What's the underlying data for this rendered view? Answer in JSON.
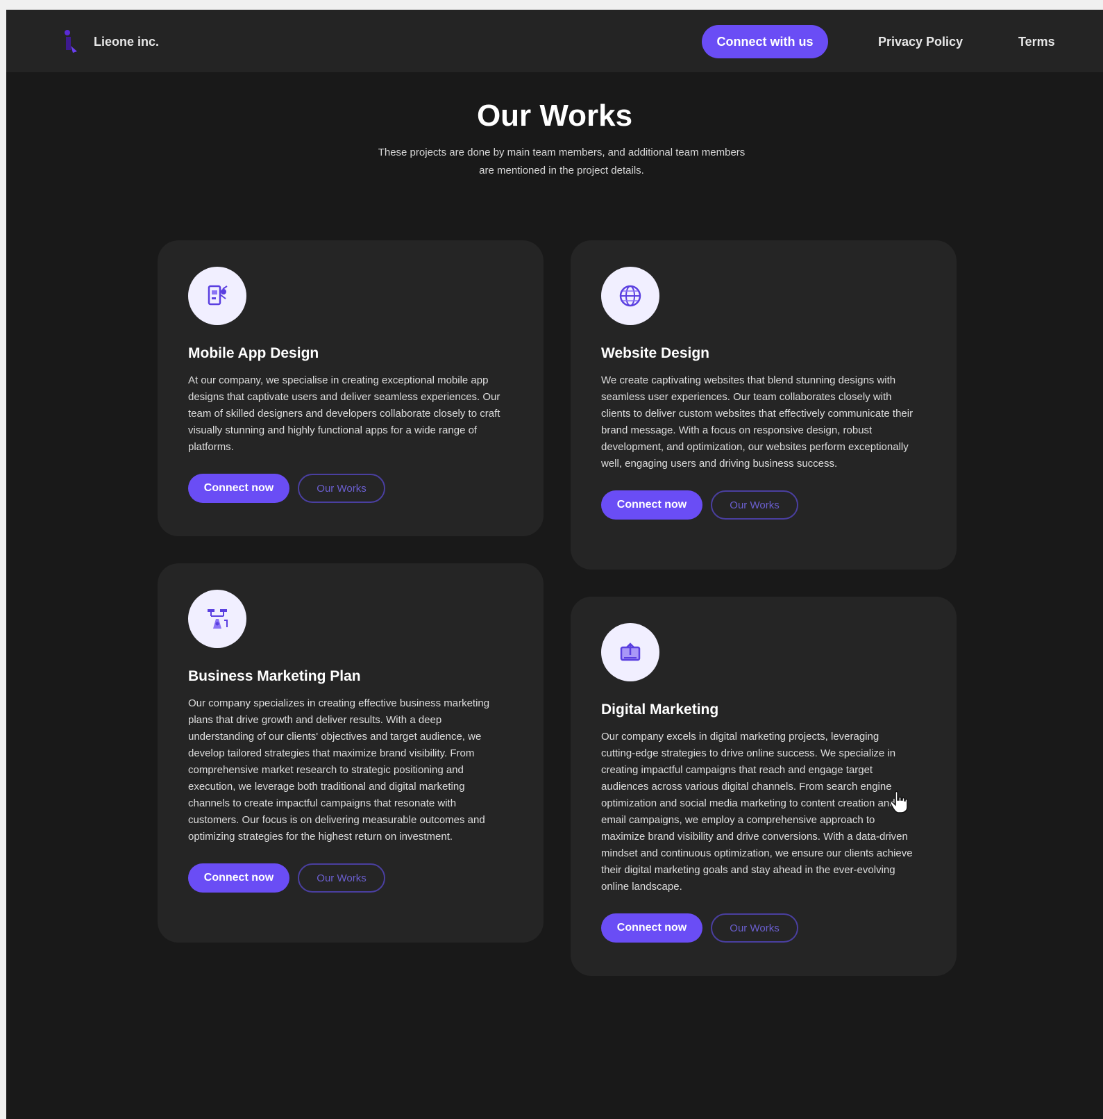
{
  "nav": {
    "brand": "Lieone inc.",
    "connect_label": "Connect with us",
    "links": [
      "Privacy Policy",
      "Terms"
    ]
  },
  "hero": {
    "title": "Our Works",
    "subtitle": "These projects are done by main team members, and additional team members are mentioned in the project details."
  },
  "cards": [
    {
      "icon": "mobile-app-icon",
      "title": "Mobile App Design",
      "text": "At our company, we specialise in creating exceptional mobile app designs that captivate users and deliver seamless experiences. Our team of skilled designers and developers collaborate closely to craft visually stunning and highly functional apps for a wide range of platforms.",
      "primary_label": "Connect now",
      "secondary_label": "Our Works"
    },
    {
      "icon": "globe-icon",
      "title": "Website Design",
      "text": "We create captivating websites that blend stunning designs with seamless user experiences. Our team collaborates closely with clients to deliver custom websites that effectively communicate their brand message. With a focus on responsive design, robust development, and optimization, our websites perform exceptionally well, engaging users and driving business success.",
      "primary_label": "Connect now",
      "secondary_label": "Our Works"
    },
    {
      "icon": "marketing-plan-icon",
      "title": "Business Marketing Plan",
      "text": "Our company specializes in creating effective business marketing plans that drive growth and deliver results. With a deep understanding of our clients' objectives and target audience, we develop tailored strategies that maximize brand visibility. From comprehensive market research to strategic positioning and execution, we leverage both traditional and digital marketing channels to create impactful campaigns that resonate with customers. Our focus is on delivering measurable outcomes and optimizing strategies for the highest return on investment.",
      "primary_label": "Connect now",
      "secondary_label": "Our Works"
    },
    {
      "icon": "digital-marketing-icon",
      "title": "Digital Marketing",
      "text": "Our company excels in digital marketing projects, leveraging cutting-edge strategies to drive online success. We specialize in creating impactful campaigns that reach and engage target audiences across various digital channels. From search engine optimization and social media marketing to content creation and email campaigns, we employ a comprehensive approach to maximize brand visibility and drive conversions. With a data-driven mindset and continuous optimization, we ensure our clients achieve their digital marketing goals and stay ahead in the ever-evolving online landscape.",
      "primary_label": "Connect now",
      "secondary_label": "Our Works"
    }
  ],
  "colors": {
    "accent": "#6a4df5",
    "background": "#191919",
    "navbar": "#242424",
    "card": "#252525"
  }
}
